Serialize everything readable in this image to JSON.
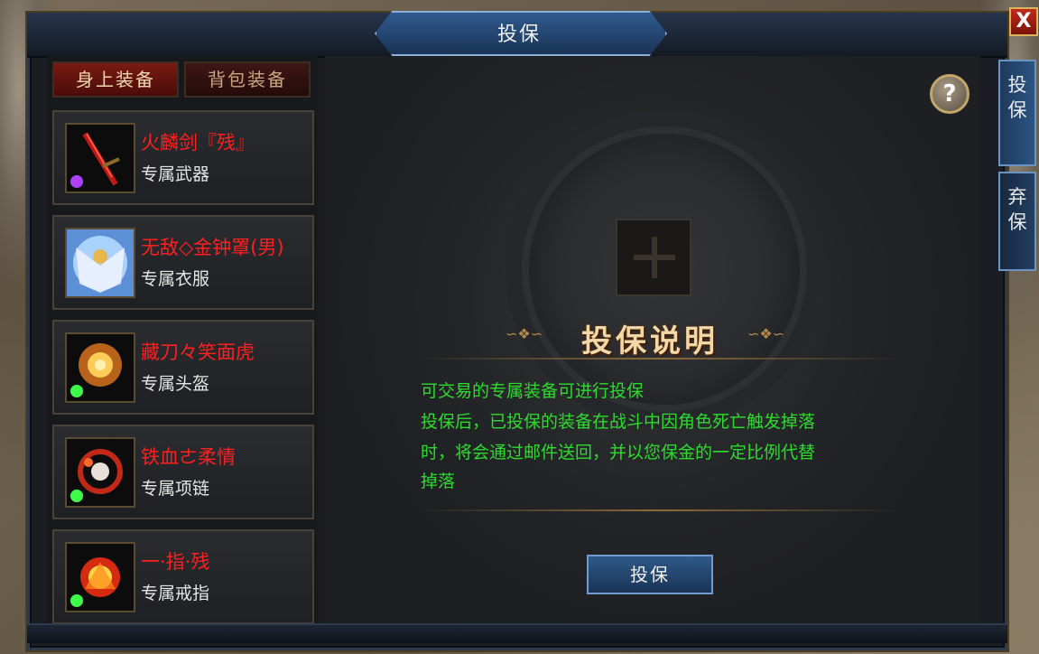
{
  "window": {
    "title": "投保",
    "close_label": "X"
  },
  "tabs": [
    {
      "label": "身上装备",
      "active": true
    },
    {
      "label": "背包装备",
      "active": false
    }
  ],
  "items": [
    {
      "name": "火麟剑『残』",
      "type": "专属武器",
      "gem": "purple"
    },
    {
      "name": "无敌◇金钟罩(男)",
      "type": "专属衣服",
      "gem": "none"
    },
    {
      "name": "藏刀々笑面虎",
      "type": "专属头盔",
      "gem": "green"
    },
    {
      "name": "铁血ㄜ柔情",
      "type": "专属项链",
      "gem": "green"
    },
    {
      "name": "一·指·残",
      "type": "专属戒指",
      "gem": "green"
    }
  ],
  "help_label": "?",
  "description": {
    "title": "投保说明",
    "lines": [
      "可交易的专属装备可进行投保",
      "投保后，已投保的装备在战斗中因角色死亡触发掉落",
      "时，将会通过邮件送回，并以您保金的一定比例代替",
      "掉落"
    ]
  },
  "action_button": "投保",
  "side_tabs": [
    {
      "label": "投保",
      "active": true
    },
    {
      "label": "弃保",
      "active": false
    }
  ],
  "colors": {
    "item_name": "#ff1f1f",
    "description_text": "#2cdc2c",
    "accent_blue": "#2e5987"
  }
}
